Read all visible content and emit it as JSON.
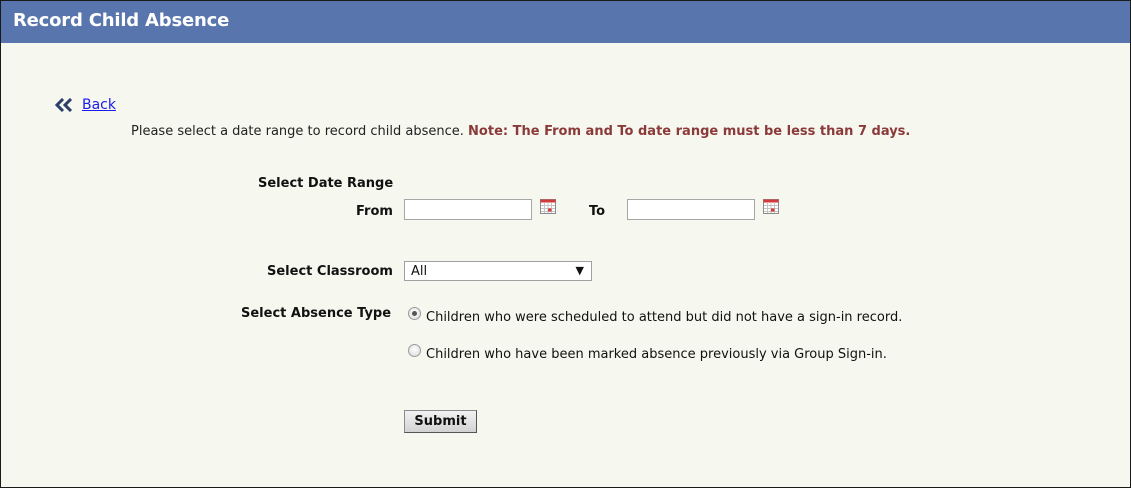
{
  "header": {
    "title": "Record Child Absence"
  },
  "back": {
    "label": "Back",
    "icon": "double-chevron-left-icon"
  },
  "instructions": {
    "text": "Please select a date range to record child absence.",
    "note": "Note: The From and To date range must be less than 7 days."
  },
  "date_range": {
    "heading": "Select Date Range",
    "from_label": "From",
    "from_value": "",
    "to_label": "To",
    "to_value": "",
    "calendar_icon": "calendar-icon"
  },
  "classroom": {
    "label": "Select Classroom",
    "selected": "All"
  },
  "absence_type": {
    "label": "Select Absence Type",
    "options": [
      {
        "label": "Children who were scheduled to attend but did not have a sign-in record.",
        "checked": true
      },
      {
        "label": "Children who have been marked absence previously via Group Sign-in.",
        "checked": false
      }
    ]
  },
  "submit": {
    "label": "Submit"
  },
  "colors": {
    "header_bg": "#5876ad",
    "page_bg": "#f6f7ee",
    "note": "#8b3a3a",
    "link": "#1a1aee",
    "calendar_accent": "#d23b3b"
  }
}
